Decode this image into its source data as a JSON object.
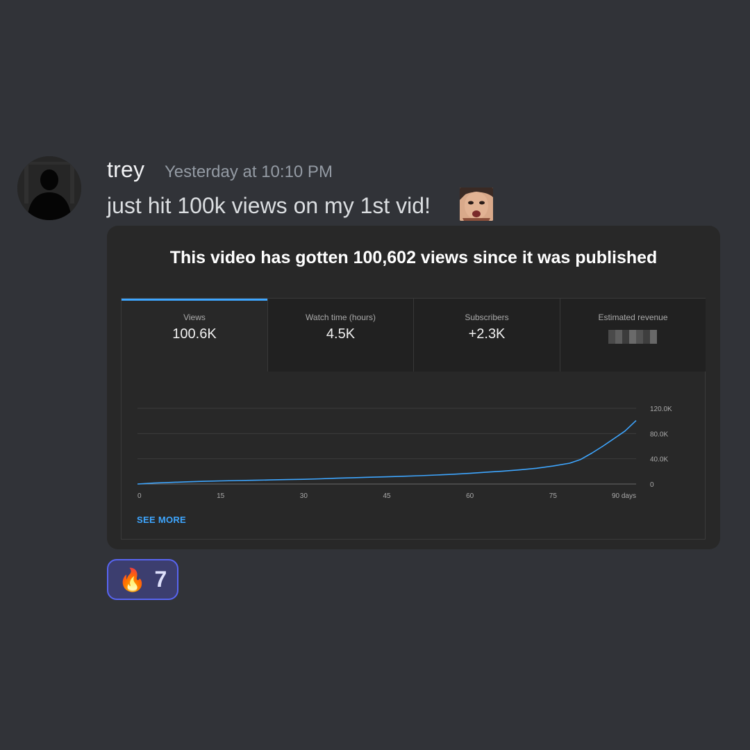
{
  "message": {
    "author": "trey",
    "timestamp": "Yesterday at 10:10 PM",
    "text": "just hit 100k views on my 1st vid!",
    "emote_icon": "pogchamp-face-emote"
  },
  "embed": {
    "title": "This video has gotten 100,602 views since it was published",
    "metrics": [
      {
        "label": "Views",
        "value": "100.6K",
        "active": true
      },
      {
        "label": "Watch time (hours)",
        "value": "4.5K",
        "active": false
      },
      {
        "label": "Subscribers",
        "value": "+2.3K",
        "active": false
      },
      {
        "label": "Estimated revenue",
        "value": "",
        "active": false,
        "redacted": true
      }
    ],
    "see_more": "SEE MORE"
  },
  "chart_data": {
    "type": "line",
    "title": "",
    "xlabel": "",
    "ylabel": "",
    "x_ticks": [
      0,
      15,
      30,
      45,
      60,
      75,
      90
    ],
    "x_tick_labels": [
      "0",
      "15",
      "30",
      "45",
      "60",
      "75",
      "90 days"
    ],
    "y_ticks": [
      0,
      40000,
      80000,
      120000
    ],
    "y_tick_labels": [
      "0",
      "40.0K",
      "80.0K",
      "120.0K"
    ],
    "xlim": [
      0,
      90
    ],
    "ylim": [
      0,
      120000
    ],
    "grid": true,
    "line_color": "#3ea6ff",
    "series": [
      {
        "x": [
          0,
          3,
          6,
          9,
          12,
          15,
          18,
          21,
          24,
          27,
          30,
          33,
          36,
          39,
          42,
          45,
          48,
          51,
          54,
          57,
          60,
          63,
          66,
          69,
          72,
          75,
          78,
          80,
          82,
          84,
          86,
          88,
          90
        ],
        "values": [
          0,
          1500,
          2500,
          3500,
          4300,
          5000,
          5500,
          6000,
          6500,
          7000,
          7500,
          8300,
          9200,
          10000,
          10800,
          11500,
          12300,
          13200,
          14300,
          15500,
          17000,
          18800,
          20500,
          22500,
          25000,
          28500,
          33000,
          39000,
          49000,
          60000,
          72000,
          84000,
          100602
        ]
      }
    ]
  },
  "reaction": {
    "emoji": "🔥",
    "count": "7"
  },
  "colors": {
    "background": "#313338",
    "accent_blue": "#3ea6ff",
    "reaction_border": "#5865f2"
  }
}
